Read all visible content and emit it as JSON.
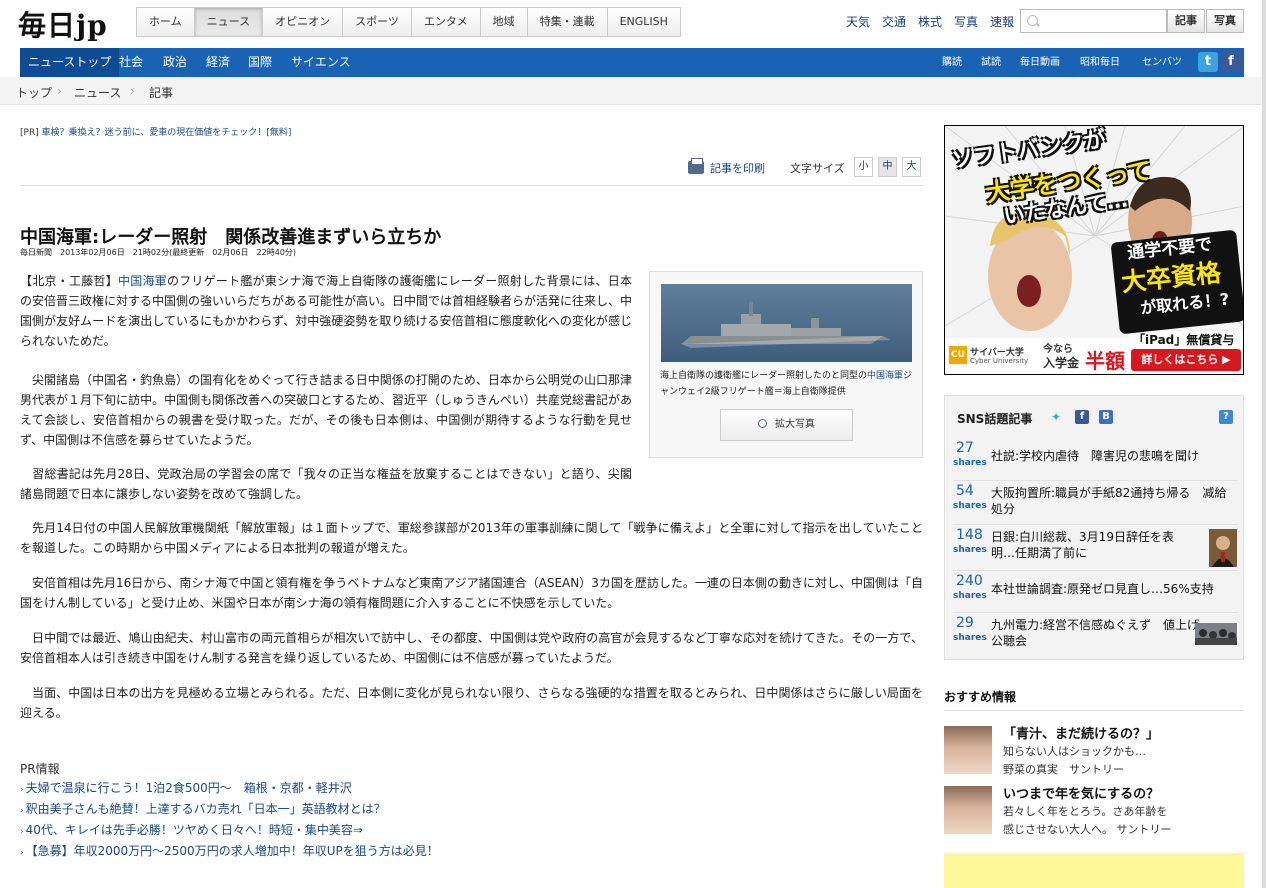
{
  "header": {
    "logo": "毎日jp",
    "global_nav": [
      "ホーム",
      "ニュース",
      "オピニオン",
      "スポーツ",
      "エンタメ",
      "地域",
      "特集・連載",
      "ENGLISH"
    ],
    "global_nav_active": "ニュース",
    "utility_links": [
      "天気",
      "交通",
      "株式",
      "写真",
      "速報"
    ],
    "search": {
      "placeholder": "",
      "btn_article": "記事",
      "btn_photo": "写真"
    }
  },
  "subnav": {
    "items": [
      "ニューストップ",
      "社会",
      "政治",
      "経済",
      "国際",
      "サイエンス"
    ],
    "right_items": [
      "購読",
      "試読",
      "毎日動画",
      "昭和毎日",
      "センバツ"
    ],
    "twitter": "t",
    "facebook": "f"
  },
  "breadcrumb": [
    "トップ",
    "ニュース",
    "記事"
  ],
  "pr_top": {
    "tag": "[PR]",
    "text": "車検？乗換え？迷う前に、愛車の現在価値をチェック！[無料]"
  },
  "tools": {
    "print": "記事を印刷",
    "font_size_label": "文字サイズ",
    "sizes": [
      "小",
      "中",
      "大"
    ],
    "active_size": "中"
  },
  "article": {
    "title": "中国海軍:レーダー照射　関係改善進まずいら立ちか",
    "dateline": "毎日新聞　2013年02月06日　21時02分(最終更新　02月06日　22時40分)",
    "lead_prefix": "【北京・工藤哲】",
    "lead_link": "中国海軍",
    "paragraphs": [
      "のフリゲート艦が東シナ海で海上自衛隊の護衛艦にレーダー照射した背景には、日本の安倍晋三政権に対する中国側の強いいらだちがある可能性が高い。日中間では首相経験者らが活発に往来し、中国側が友好ムードを演出しているにもかかわらず、対中強硬姿勢を取り続ける安倍首相に態度軟化への変化が感じられないためだ。",
      "　尖閣諸島（中国名・釣魚島）の国有化をめぐって行き詰まる日中関係の打開のため、日本から公明党の山口那津男代表が１月下旬に訪中。中国側も関係改善への突破口とするため、習近平（しゅうきんぺい）共産党総書記があえて会談し、安倍首相からの親書を受け取った。だが、その後も日本側は、中国側が期待するような行動を見せず、中国側は不信感を募らせていたようだ。",
      "　習総書記は先月28日、党政治局の学習会の席で「我々の正当な権益を放棄することはできない」と語り、尖閣諸島問題で日本に譲歩しない姿勢を改めて強調した。",
      "　先月14日付の中国人民解放軍機関紙「解放軍報」は１面トップで、軍総参謀部が2013年の軍事訓練に関して「戦争に備えよ」と全軍に対して指示を出していたことを報道した。この時期から中国メディアによる日本批判の報道が増えた。",
      "　安倍首相は先月16日から、南シナ海で中国と領有権を争うベトナムなど東南アジア諸国連合（ASEAN）3カ国を歴訪した。一連の日本側の動きに対し、中国側は「自国をけん制している」と受け止め、米国や日本が南シナ海の領有権問題に介入することに不快感を示していた。",
      "　日中間では最近、鳩山由紀夫、村山富市の両元首相らが相次いで訪中し、その都度、中国側は党や政府の高官が会見するなど丁寧な応対を続けてきた。その一方で、安倍首相本人は引き続き中国をけん制する発言を繰り返しているため、中国側には不信感が募っていたようだ。",
      "　当面、中国は日本の出方を見極める立場とみられる。ただ、日本側に変化が見られない限り、さらなる強硬的な措置を取るとみられ、日中関係はさらに厳しい局面を迎える。"
    ],
    "photo_caption_prefix": "海上自衛隊の護衛艦にレーダー照射したのと同型の",
    "photo_caption_link": "中国海軍",
    "photo_caption_suffix": "ジャンウェイ2級フリゲート艦＝海上自衛隊提供",
    "enlarge_button": "拡大写真"
  },
  "pr_info": {
    "heading": "PR情報",
    "items": [
      "夫婦で温泉に行こう！1泊2食500円〜　箱根・京都・軽井沢",
      "釈由美子さんも絶賛！上達するバカ売れ「日本一」英語教材とは？",
      "40代、キレイは先手必勝！ツヤめく日々へ！時短・集中美容⇒",
      "【急募】年収2000万円〜2500万円の求人増加中！年収UPを狙う方は必見！"
    ]
  },
  "ad": {
    "headline_1": "ソフトバンクが",
    "headline_2": "大学をつくって",
    "headline_3": "いたなんて…",
    "bubble_1": "通学不要で",
    "bubble_2": "大卒資格",
    "bubble_3": "が取れる！?",
    "brand_mark": "CU",
    "brand": "サイバー大学",
    "brand_en": "Cyber University",
    "promo_1": "今なら",
    "promo_2": "入学金",
    "promo_3": "半額",
    "ipad": "「iPad」無償貸与",
    "cta": "詳しくはこちら ▶"
  },
  "sns": {
    "title": "SNS話題記事",
    "help": "?",
    "shares_label": "shares",
    "items": [
      {
        "count": "27",
        "text": "社説:学校内虐待　障害児の悲鳴を聞け"
      },
      {
        "count": "54",
        "text": "大阪拘置所:職員が手紙82通持ち帰る　减給処分"
      },
      {
        "count": "148",
        "text": "日銀:白川総裁、3月19日辞任を表明…任期満了前に"
      },
      {
        "count": "240",
        "text": "本社世論調査:原発ゼロ見直し…56%支持"
      },
      {
        "count": "29",
        "text": "九州電力:経営不信感ぬぐえず　値上げ公聴会"
      }
    ]
  },
  "recommend": {
    "heading": "おすすめ情報",
    "items": [
      {
        "title": "「青汁、まだ続けるの？」",
        "sub1": "知らない人はショックかも…",
        "sub2": "野菜の真実　サントリー"
      },
      {
        "title": "いつまで年を気にするの？",
        "sub1": "若々しく年をとろう。さあ年齢を",
        "sub2": "感じさせない大人へ。 サントリー"
      }
    ]
  }
}
